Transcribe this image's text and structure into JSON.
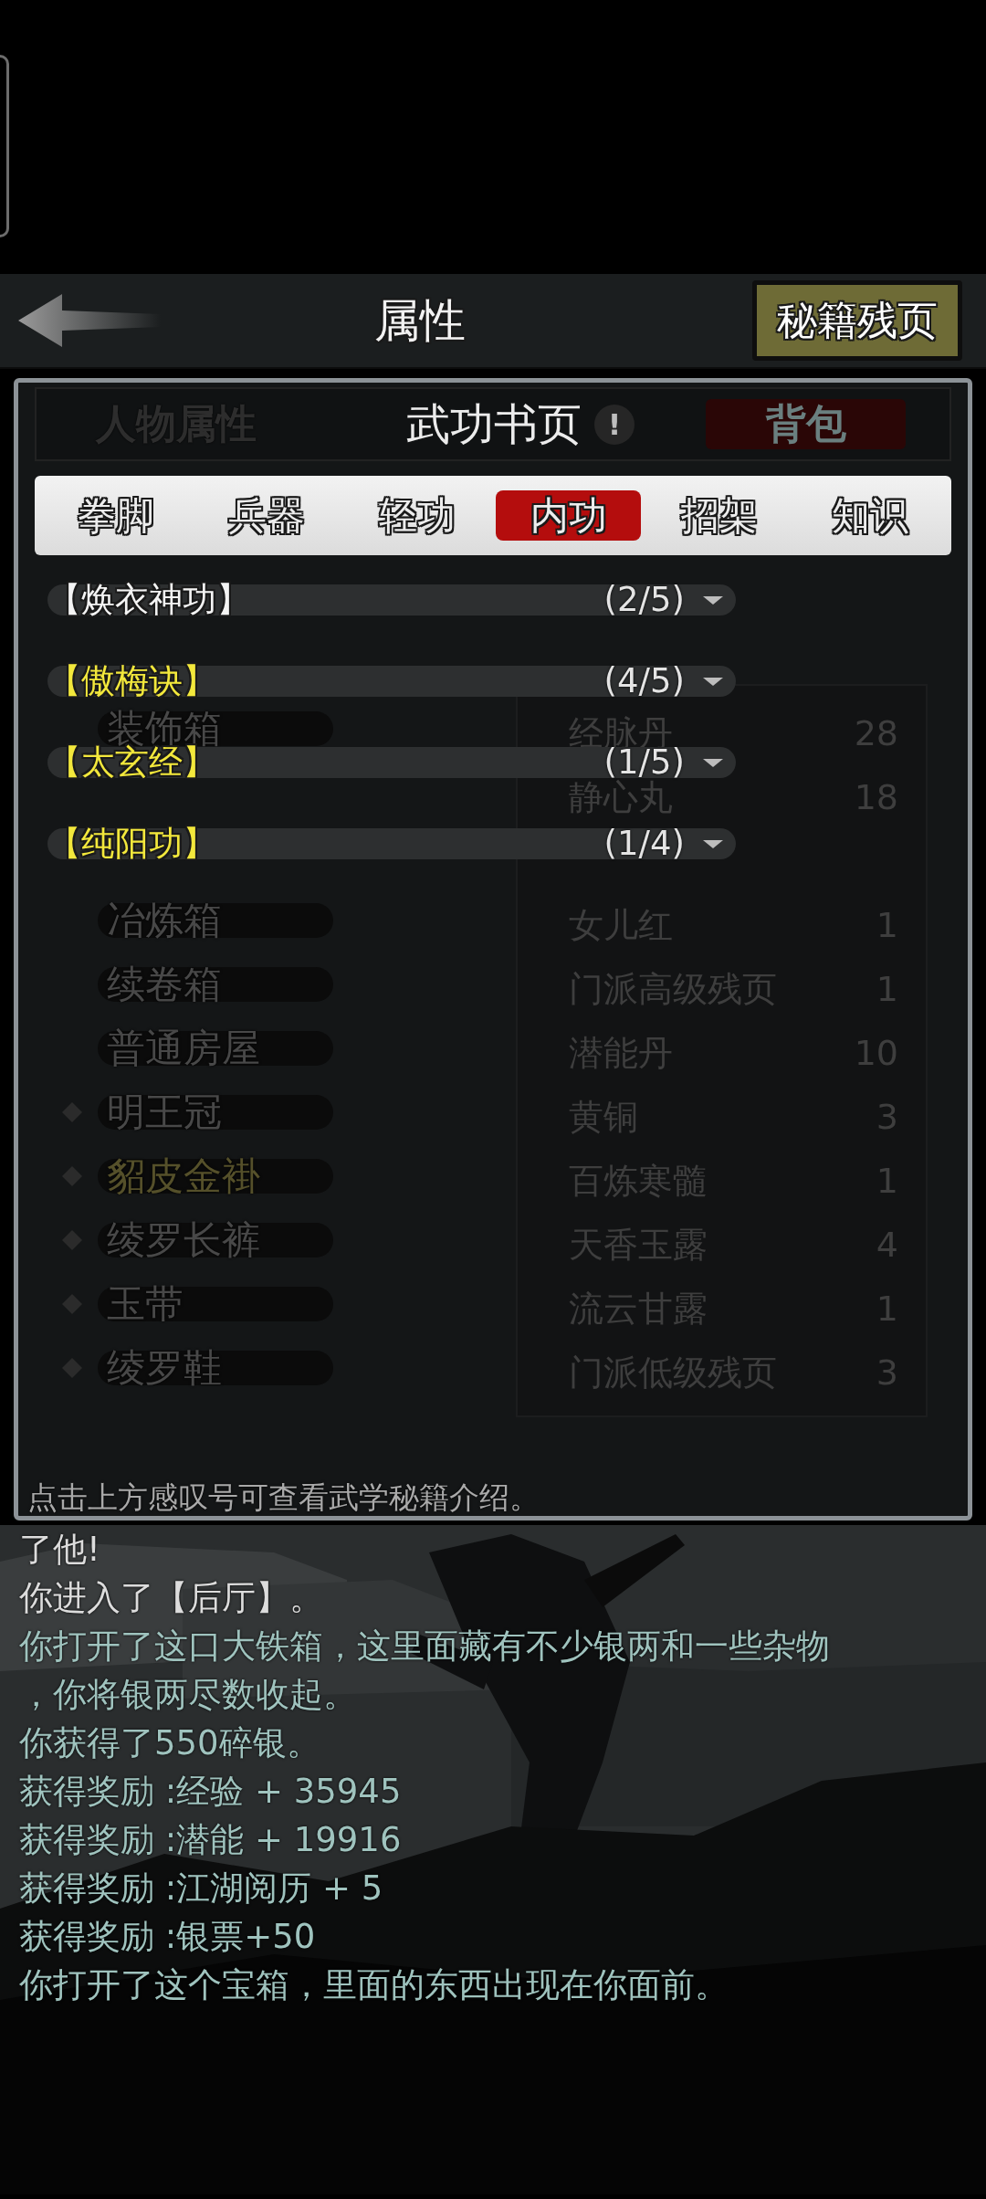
{
  "header": {
    "title": "属性",
    "action_button": "秘籍残页"
  },
  "panel": {
    "title": "武功书页",
    "info_mark": "!",
    "behind_left": "人物属性",
    "behind_right": "背包",
    "tabs": [
      {
        "label": "拳脚",
        "selected": false
      },
      {
        "label": "兵器",
        "selected": false
      },
      {
        "label": "轻功",
        "selected": false
      },
      {
        "label": "内功",
        "selected": true
      },
      {
        "label": "招架",
        "selected": false
      },
      {
        "label": "知识",
        "selected": false
      }
    ],
    "skills": [
      {
        "name": "【焕衣神功】",
        "progress": "(2/5)",
        "color": "#f4f4f4"
      },
      {
        "name": "【傲梅诀】",
        "progress": "(4/5)",
        "color": "#f3e83c"
      },
      {
        "name": "【太玄经】",
        "progress": "(1/5)",
        "color": "#f3e83c"
      },
      {
        "name": "【纯阳功】",
        "progress": "(1/4)",
        "color": "#f3e83c"
      }
    ],
    "behind_items": [
      {
        "name": "装饰箱",
        "kind": "container",
        "color": "#484848"
      },
      {
        "name": "冶炼箱",
        "kind": "container",
        "color": "#484848"
      },
      {
        "name": "续卷箱",
        "kind": "container",
        "color": "#484848"
      },
      {
        "name": "普通房屋",
        "kind": "container",
        "color": "#484848"
      },
      {
        "name": "明王冠",
        "kind": "equipment",
        "color": "#484848"
      },
      {
        "name": "貂皮金褂",
        "kind": "equipment",
        "color": "#55502a"
      },
      {
        "name": "绫罗长裤",
        "kind": "equipment",
        "color": "#484848"
      },
      {
        "name": "玉带",
        "kind": "equipment",
        "color": "#484848"
      },
      {
        "name": "绫罗鞋",
        "kind": "equipment",
        "color": "#484848"
      }
    ],
    "behind_bag": [
      {
        "name": "经脉丹",
        "count": "28"
      },
      {
        "name": "静心丸",
        "count": "18"
      },
      {
        "name": "女儿红",
        "count": "1"
      },
      {
        "name": "门派高级残页",
        "count": "1"
      },
      {
        "name": "潜能丹",
        "count": "10"
      },
      {
        "name": "黄铜",
        "count": "3"
      },
      {
        "name": "百炼寒髓",
        "count": "1"
      },
      {
        "name": "天香玉露",
        "count": "4"
      },
      {
        "name": "流云甘露",
        "count": "1"
      },
      {
        "name": "门派低级残页",
        "count": "3"
      }
    ],
    "hint": "点击上方感叹号可查看武学秘籍介绍。"
  },
  "log": [
    {
      "text": "了他!",
      "color": "#dcdcdc"
    },
    {
      "text": "你进入了【后厅】。",
      "color": "#dcdcdc"
    },
    {
      "text": "你打开了这口大铁箱，这里面藏有不少银两和一些杂物",
      "color": "#9fc3be"
    },
    {
      "text": "，你将银两尽数收起。",
      "color": "#9fc3be"
    },
    {
      "text": "你获得了550碎银。",
      "color": "#9fc3be"
    },
    {
      "text": "获得奖励 :经验 + 35945",
      "color": "#9fc3be"
    },
    {
      "text": "获得奖励 :潜能 + 19916",
      "color": "#9fc3be"
    },
    {
      "text": "获得奖励 :江湖阅历 + 5",
      "color": "#9fc3be"
    },
    {
      "text": "获得奖励 :银票+50",
      "color": "#9fc3be"
    },
    {
      "text": "你打开了这个宝箱，里面的东西出现在你面前。",
      "color": "#9fc3be"
    }
  ]
}
